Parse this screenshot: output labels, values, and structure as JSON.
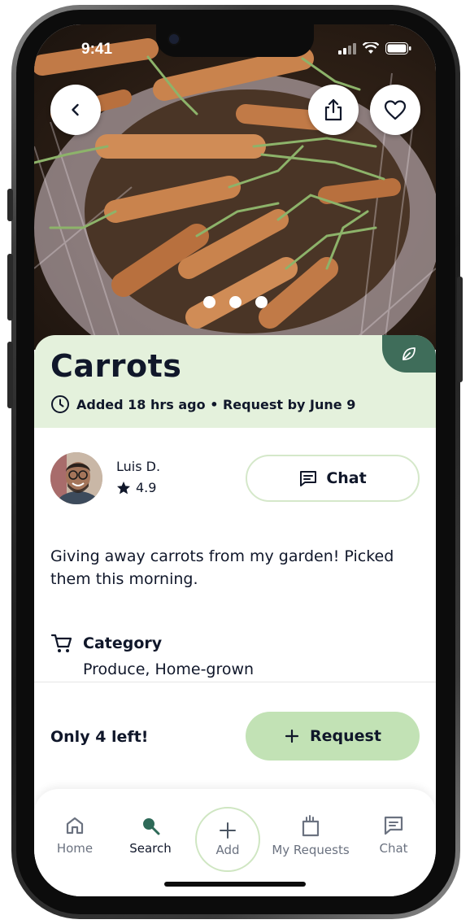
{
  "status_bar": {
    "time": "9:41"
  },
  "product": {
    "title": "Carrots",
    "meta": "Added 18 hrs ago • Request by June 9",
    "image_carousel": {
      "page_count": 3,
      "current_page": 1
    },
    "description": "Giving away carrots from my garden! Picked them this morning.",
    "category_label": "Category",
    "category_value": "Produce, Home-grown",
    "stock_text": "Only 4 left!"
  },
  "seller": {
    "name": "Luis D.",
    "rating": "4.9"
  },
  "actions": {
    "chat_label": "Chat",
    "request_label": "Request"
  },
  "nav": {
    "items": [
      {
        "label": "Home",
        "icon": "home-icon"
      },
      {
        "label": "Search",
        "icon": "search-icon"
      },
      {
        "label": "Add",
        "icon": "plus-icon"
      },
      {
        "label": "My Requests",
        "icon": "shopping-bag-icon"
      },
      {
        "label": "Chat",
        "icon": "chat-icon"
      }
    ],
    "active": "Search"
  },
  "colors": {
    "title_panel_bg": "#e4f1dc",
    "accent_dark_green": "#3f6d5a",
    "request_button_bg": "#c2e2b5",
    "text_dark": "#10172a",
    "nav_inactive": "#6b7280"
  }
}
